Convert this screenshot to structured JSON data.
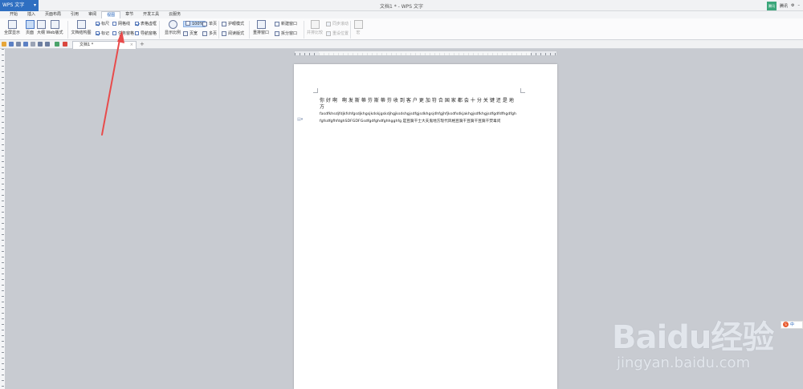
{
  "app": {
    "name": "WPS 文字",
    "doc_title": "文档1 * - WPS 文字",
    "user": "腾讯",
    "user_name": "腾讯",
    "right_label": "建议"
  },
  "menu": [
    "开始",
    "插入",
    "页面布局",
    "引用",
    "审阅",
    "视图",
    "章节",
    "开发工具",
    "云服务"
  ],
  "active_menu": "视图",
  "ribbon": {
    "fullscreen": "全屏显示",
    "page_view": "页面",
    "outline": "大纲",
    "web_layout": "Web版式",
    "doc_structure": "文档结构图",
    "ruler": "标尺",
    "gridlines": "网格线",
    "table_gridlines": "表格虚框",
    "markup": "标记",
    "task_pane": "任务窗格",
    "nav_pane": "导航窗格",
    "zoom": "显示比例",
    "zoom_100": "100%",
    "one_page": "单页",
    "page_width": "页宽",
    "multi_page": "多页",
    "eye_mode": "护眼模式",
    "reading_mode": "阅读版式",
    "rearrange": "重排窗口",
    "new_window": "新建窗口",
    "split_window": "拆分窗口",
    "sync_scroll": "并排比较",
    "sync_scroll2": "同步滚动",
    "reset_position": "重设位置",
    "macro": "宏"
  },
  "tabs": {
    "doc": "文档1 *"
  },
  "document": {
    "line1": "你好啊  啊发斯蒂芬斯蒂芬收到客户更加符合国家都会十分关键还是地方",
    "line2": "fasdfkhsdjfdjkfshfgsdjkhgsjkdskjgskdjhgjksdshgjsdfgjsdkhgsjdhfgjhfjksdfsdkjakhgjsdfkhgjsdfgdfdfhgdfghfgfsdfgfhfdghSDFGDFGsdfgdfghdfghhgghfg 是豆腐干士大夫鬼地方现代风格豆腐干豆腐干豆腐干焚毒问"
  },
  "watermark": {
    "brand": "Baidu经验",
    "url": "jingyan.baidu.com"
  },
  "ime": {
    "label": "中"
  },
  "colors": {
    "accent": "#2f6fc1",
    "arrow": "#e84b4b"
  }
}
